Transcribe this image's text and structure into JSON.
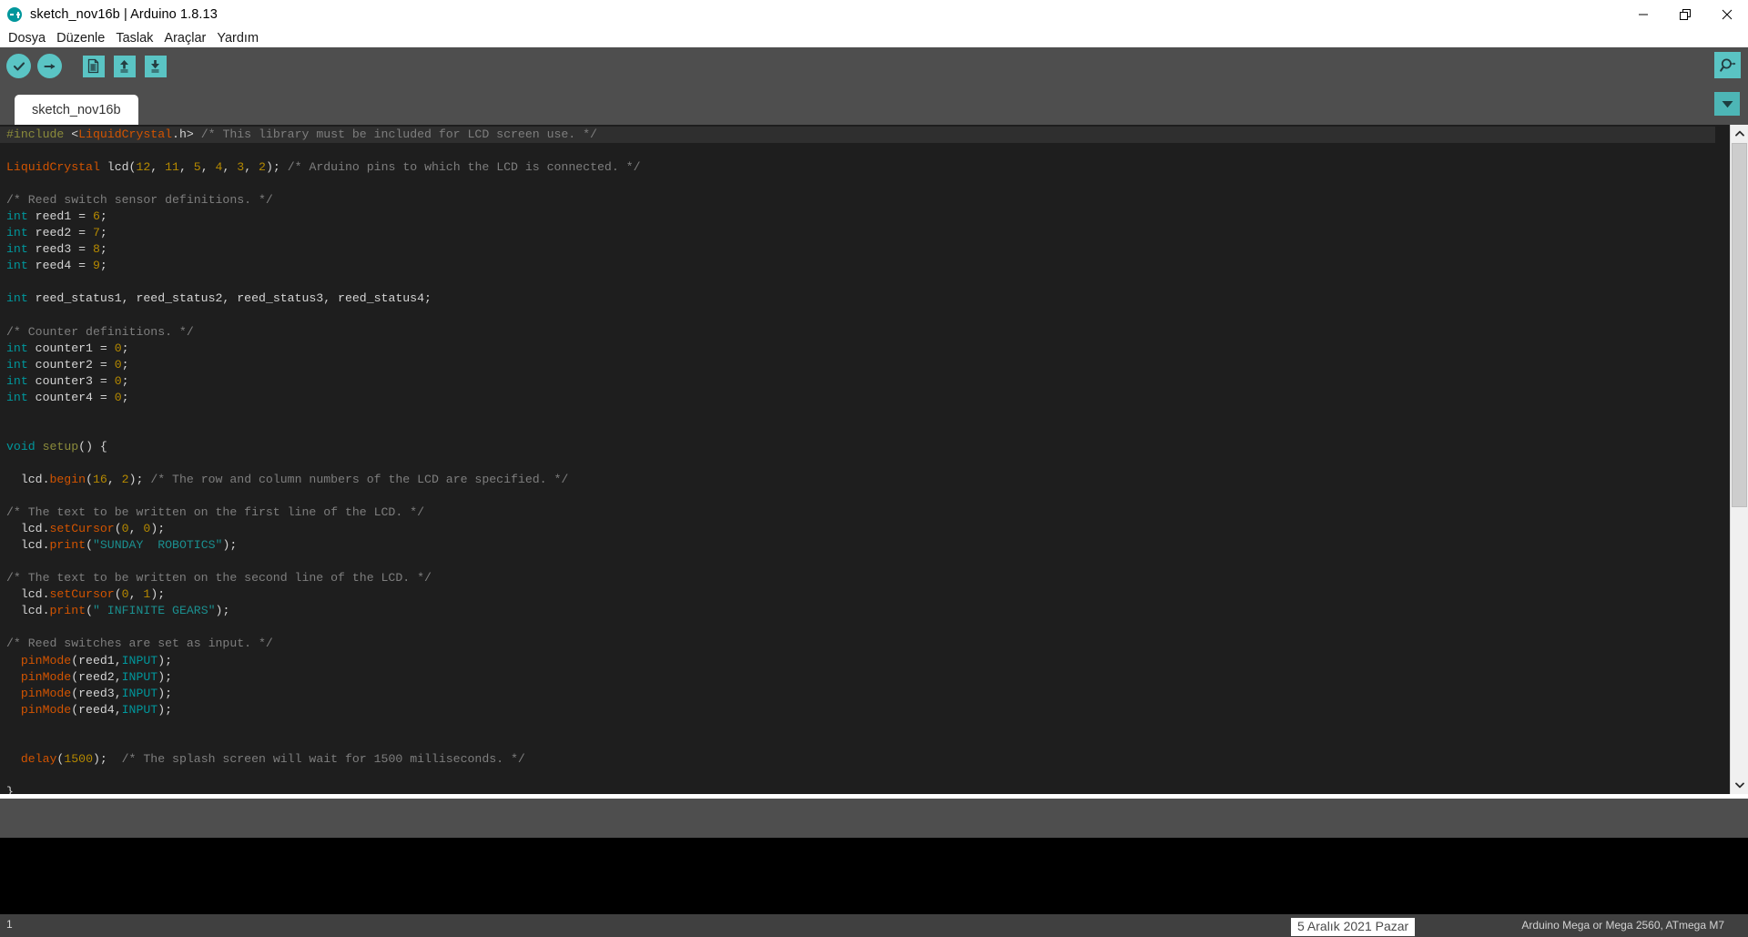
{
  "window": {
    "title": "sketch_nov16b | Arduino 1.8.13",
    "logo_icon": "arduino-infinity-logo",
    "minimize_icon": "minimize-icon",
    "maximize_icon": "restore-window-icon",
    "close_icon": "close-icon"
  },
  "menu": {
    "items": [
      {
        "label": "Dosya",
        "name": "menu-file"
      },
      {
        "label": "Düzenle",
        "name": "menu-edit"
      },
      {
        "label": "Taslak",
        "name": "menu-sketch"
      },
      {
        "label": "Araçlar",
        "name": "menu-tools"
      },
      {
        "label": "Yardım",
        "name": "menu-help"
      }
    ]
  },
  "toolbar": {
    "verify_icon": "checkmark-verify-icon",
    "upload_icon": "arrow-right-upload-icon",
    "new_icon": "new-sketch-icon",
    "open_icon": "arrow-up-open-icon",
    "save_icon": "arrow-down-save-icon",
    "serial_monitor_icon": "magnifier-serial-monitor-icon"
  },
  "tabs": {
    "active": "sketch_nov16b",
    "items": [
      {
        "label": "sketch_nov16b",
        "name": "tab-sketch-nov16b"
      }
    ],
    "dropdown_icon": "chevron-down-icon"
  },
  "scrollbar": {
    "up_icon": "chevron-up-icon",
    "down_icon": "chevron-down-icon"
  },
  "status": {
    "line_number": "1",
    "board": "Arduino Mega or Mega 2560, ATmega                  M7",
    "tooltip": "5 Aralık 2021 Pazar"
  },
  "code": {
    "lines": [
      {
        "current": true,
        "tokens": [
          {
            "c": "t-pre",
            "t": "#include "
          },
          {
            "c": "t-plain",
            "t": "<"
          },
          {
            "c": "t-cls",
            "t": "LiquidCrystal"
          },
          {
            "c": "t-plain",
            "t": ".h> "
          },
          {
            "c": "t-com",
            "t": "/* This library must be included for LCD screen use. */"
          }
        ]
      },
      {
        "tokens": []
      },
      {
        "tokens": [
          {
            "c": "t-cls",
            "t": "LiquidCrystal"
          },
          {
            "c": "t-plain",
            "t": " lcd("
          },
          {
            "c": "t-num",
            "t": "12"
          },
          {
            "c": "t-plain",
            "t": ", "
          },
          {
            "c": "t-num",
            "t": "11"
          },
          {
            "c": "t-plain",
            "t": ", "
          },
          {
            "c": "t-num",
            "t": "5"
          },
          {
            "c": "t-plain",
            "t": ", "
          },
          {
            "c": "t-num",
            "t": "4"
          },
          {
            "c": "t-plain",
            "t": ", "
          },
          {
            "c": "t-num",
            "t": "3"
          },
          {
            "c": "t-plain",
            "t": ", "
          },
          {
            "c": "t-num",
            "t": "2"
          },
          {
            "c": "t-plain",
            "t": "); "
          },
          {
            "c": "t-com",
            "t": "/* Arduino pins to which the LCD is connected. */"
          }
        ]
      },
      {
        "tokens": []
      },
      {
        "tokens": [
          {
            "c": "t-com",
            "t": "/* Reed switch sensor definitions. */"
          }
        ]
      },
      {
        "tokens": [
          {
            "c": "t-type",
            "t": "int"
          },
          {
            "c": "t-plain",
            "t": " reed1 = "
          },
          {
            "c": "t-num",
            "t": "6"
          },
          {
            "c": "t-plain",
            "t": ";"
          }
        ]
      },
      {
        "tokens": [
          {
            "c": "t-type",
            "t": "int"
          },
          {
            "c": "t-plain",
            "t": " reed2 = "
          },
          {
            "c": "t-num",
            "t": "7"
          },
          {
            "c": "t-plain",
            "t": ";"
          }
        ]
      },
      {
        "tokens": [
          {
            "c": "t-type",
            "t": "int"
          },
          {
            "c": "t-plain",
            "t": " reed3 = "
          },
          {
            "c": "t-num",
            "t": "8"
          },
          {
            "c": "t-plain",
            "t": ";"
          }
        ]
      },
      {
        "tokens": [
          {
            "c": "t-type",
            "t": "int"
          },
          {
            "c": "t-plain",
            "t": " reed4 = "
          },
          {
            "c": "t-num",
            "t": "9"
          },
          {
            "c": "t-plain",
            "t": ";"
          }
        ]
      },
      {
        "tokens": []
      },
      {
        "tokens": [
          {
            "c": "t-type",
            "t": "int"
          },
          {
            "c": "t-plain",
            "t": " reed_status1, reed_status2, reed_status3, reed_status4;"
          }
        ]
      },
      {
        "tokens": []
      },
      {
        "tokens": [
          {
            "c": "t-com",
            "t": "/* Counter definitions. */"
          }
        ]
      },
      {
        "tokens": [
          {
            "c": "t-type",
            "t": "int"
          },
          {
            "c": "t-plain",
            "t": " counter1 = "
          },
          {
            "c": "t-num",
            "t": "0"
          },
          {
            "c": "t-plain",
            "t": ";"
          }
        ]
      },
      {
        "tokens": [
          {
            "c": "t-type",
            "t": "int"
          },
          {
            "c": "t-plain",
            "t": " counter2 = "
          },
          {
            "c": "t-num",
            "t": "0"
          },
          {
            "c": "t-plain",
            "t": ";"
          }
        ]
      },
      {
        "tokens": [
          {
            "c": "t-type",
            "t": "int"
          },
          {
            "c": "t-plain",
            "t": " counter3 = "
          },
          {
            "c": "t-num",
            "t": "0"
          },
          {
            "c": "t-plain",
            "t": ";"
          }
        ]
      },
      {
        "tokens": [
          {
            "c": "t-type",
            "t": "int"
          },
          {
            "c": "t-plain",
            "t": " counter4 = "
          },
          {
            "c": "t-num",
            "t": "0"
          },
          {
            "c": "t-plain",
            "t": ";"
          }
        ]
      },
      {
        "tokens": []
      },
      {
        "tokens": []
      },
      {
        "tokens": [
          {
            "c": "t-type",
            "t": "void"
          },
          {
            "c": "t-plain",
            "t": " "
          },
          {
            "c": "t-fn2",
            "t": "setup"
          },
          {
            "c": "t-plain",
            "t": "() {"
          }
        ]
      },
      {
        "tokens": []
      },
      {
        "tokens": [
          {
            "c": "t-plain",
            "t": "  lcd."
          },
          {
            "c": "t-fn",
            "t": "begin"
          },
          {
            "c": "t-plain",
            "t": "("
          },
          {
            "c": "t-num",
            "t": "16"
          },
          {
            "c": "t-plain",
            "t": ", "
          },
          {
            "c": "t-num",
            "t": "2"
          },
          {
            "c": "t-plain",
            "t": "); "
          },
          {
            "c": "t-com",
            "t": "/* The row and column numbers of the LCD are specified. */"
          }
        ]
      },
      {
        "tokens": []
      },
      {
        "tokens": [
          {
            "c": "t-com",
            "t": "/* The text to be written on the first line of the LCD. */"
          }
        ]
      },
      {
        "tokens": [
          {
            "c": "t-plain",
            "t": "  lcd."
          },
          {
            "c": "t-fn",
            "t": "setCursor"
          },
          {
            "c": "t-plain",
            "t": "("
          },
          {
            "c": "t-num",
            "t": "0"
          },
          {
            "c": "t-plain",
            "t": ", "
          },
          {
            "c": "t-num",
            "t": "0"
          },
          {
            "c": "t-plain",
            "t": ");"
          }
        ]
      },
      {
        "tokens": [
          {
            "c": "t-plain",
            "t": "  lcd."
          },
          {
            "c": "t-fn",
            "t": "print"
          },
          {
            "c": "t-plain",
            "t": "("
          },
          {
            "c": "t-str",
            "t": "\"SUNDAY  ROBOTICS\""
          },
          {
            "c": "t-plain",
            "t": ");"
          }
        ]
      },
      {
        "tokens": []
      },
      {
        "tokens": [
          {
            "c": "t-com",
            "t": "/* The text to be written on the second line of the LCD. */"
          }
        ]
      },
      {
        "tokens": [
          {
            "c": "t-plain",
            "t": "  lcd."
          },
          {
            "c": "t-fn",
            "t": "setCursor"
          },
          {
            "c": "t-plain",
            "t": "("
          },
          {
            "c": "t-num",
            "t": "0"
          },
          {
            "c": "t-plain",
            "t": ", "
          },
          {
            "c": "t-num",
            "t": "1"
          },
          {
            "c": "t-plain",
            "t": ");"
          }
        ]
      },
      {
        "tokens": [
          {
            "c": "t-plain",
            "t": "  lcd."
          },
          {
            "c": "t-fn",
            "t": "print"
          },
          {
            "c": "t-plain",
            "t": "("
          },
          {
            "c": "t-str",
            "t": "\" INFINITE GEARS\""
          },
          {
            "c": "t-plain",
            "t": ");"
          }
        ]
      },
      {
        "tokens": []
      },
      {
        "tokens": [
          {
            "c": "t-com",
            "t": "/* Reed switches are set as input. */"
          }
        ]
      },
      {
        "tokens": [
          {
            "c": "t-plain",
            "t": "  "
          },
          {
            "c": "t-fn",
            "t": "pinMode"
          },
          {
            "c": "t-plain",
            "t": "(reed1,"
          },
          {
            "c": "t-const",
            "t": "INPUT"
          },
          {
            "c": "t-plain",
            "t": ");"
          }
        ]
      },
      {
        "tokens": [
          {
            "c": "t-plain",
            "t": "  "
          },
          {
            "c": "t-fn",
            "t": "pinMode"
          },
          {
            "c": "t-plain",
            "t": "(reed2,"
          },
          {
            "c": "t-const",
            "t": "INPUT"
          },
          {
            "c": "t-plain",
            "t": ");"
          }
        ]
      },
      {
        "tokens": [
          {
            "c": "t-plain",
            "t": "  "
          },
          {
            "c": "t-fn",
            "t": "pinMode"
          },
          {
            "c": "t-plain",
            "t": "(reed3,"
          },
          {
            "c": "t-const",
            "t": "INPUT"
          },
          {
            "c": "t-plain",
            "t": ");"
          }
        ]
      },
      {
        "tokens": [
          {
            "c": "t-plain",
            "t": "  "
          },
          {
            "c": "t-fn",
            "t": "pinMode"
          },
          {
            "c": "t-plain",
            "t": "(reed4,"
          },
          {
            "c": "t-const",
            "t": "INPUT"
          },
          {
            "c": "t-plain",
            "t": ");"
          }
        ]
      },
      {
        "tokens": []
      },
      {
        "tokens": []
      },
      {
        "tokens": [
          {
            "c": "t-plain",
            "t": "  "
          },
          {
            "c": "t-fn",
            "t": "delay"
          },
          {
            "c": "t-plain",
            "t": "("
          },
          {
            "c": "t-num",
            "t": "1500"
          },
          {
            "c": "t-plain",
            "t": ");  "
          },
          {
            "c": "t-com",
            "t": "/* The splash screen will wait for 1500 milliseconds. */"
          }
        ]
      },
      {
        "tokens": []
      },
      {
        "tokens": [
          {
            "c": "t-plain",
            "t": "}"
          }
        ]
      }
    ]
  }
}
